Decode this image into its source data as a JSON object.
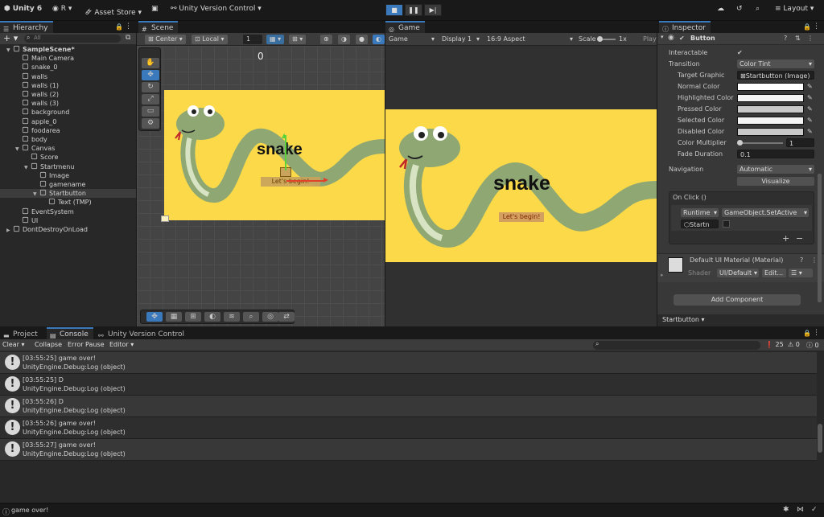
{
  "topbar": {
    "app_label": "Unity 6",
    "account_label": "R",
    "asset_store_label": "Asset Store",
    "version_control_label": "Unity Version Control",
    "layout_label": "Layout"
  },
  "hierarchy": {
    "tab_label": "Hierarchy",
    "search_placeholder": "All",
    "items": [
      {
        "label": "SampleScene*",
        "depth": 0
      },
      {
        "label": "Main Camera",
        "depth": 1
      },
      {
        "label": "snake_0",
        "depth": 1
      },
      {
        "label": "walls",
        "depth": 1
      },
      {
        "label": "walls (1)",
        "depth": 1
      },
      {
        "label": "walls (2)",
        "depth": 1
      },
      {
        "label": "walls (3)",
        "depth": 1
      },
      {
        "label": "background",
        "depth": 1
      },
      {
        "label": "apple_0",
        "depth": 1
      },
      {
        "label": "foodarea",
        "depth": 1
      },
      {
        "label": "body",
        "depth": 1
      },
      {
        "label": "Canvas",
        "depth": 1
      },
      {
        "label": "Score",
        "depth": 2
      },
      {
        "label": "Startmenu",
        "depth": 2
      },
      {
        "label": "Image",
        "depth": 3
      },
      {
        "label": "gamename",
        "depth": 3
      },
      {
        "label": "Startbutton",
        "depth": 3
      },
      {
        "label": "Text (TMP)",
        "depth": 4
      },
      {
        "label": "EventSystem",
        "depth": 1
      },
      {
        "label": "UI",
        "depth": 1
      },
      {
        "label": "DontDestroyOnLoad",
        "depth": 0
      }
    ]
  },
  "scene": {
    "tab_label": "Scene",
    "pivot_label": "Center",
    "space_label": "Local",
    "snap_value": "1",
    "score_text": "0",
    "title_text": "snake",
    "button_text": "Let's begin!"
  },
  "game": {
    "tab_label": "Game",
    "mode_label": "Game",
    "display_label": "Display 1",
    "aspect_label": "16:9 Aspect",
    "scale_label": "Scale",
    "scale_value": "1x",
    "play_label": "Play",
    "title_text": "snake",
    "button_text": "Let's begin!"
  },
  "inspector": {
    "tab_label": "Inspector",
    "component_title": "Button",
    "interactable_label": "Interactable",
    "transition_label": "Transition",
    "transition_value": "Color Tint",
    "target_graphic_label": "Target Graphic",
    "target_graphic_value": "Startbutton (Image)",
    "normal_color_label": "Normal Color",
    "highlighted_color_label": "Highlighted Color",
    "pressed_color_label": "Pressed Color",
    "selected_color_label": "Selected Color",
    "disabled_color_label": "Disabled Color",
    "color_multiplier_label": "Color Multiplier",
    "color_multiplier_value": "1",
    "fade_duration_label": "Fade Duration",
    "fade_duration_value": "0.1",
    "navigation_label": "Navigation",
    "navigation_value": "Automatic",
    "visualize_label": "Visualize",
    "onclick_label": "On Click ()",
    "runtime_value": "Runtime",
    "function_value": "GameObject.SetActive",
    "object_value": "Startn",
    "material_title": "Default UI Material (Material)",
    "shader_label": "Shader",
    "shader_value": "UI/Default",
    "edit_label": "Edit...",
    "add_component_label": "Add Component",
    "footer_object": "Startbutton"
  },
  "console": {
    "project_tab": "Project",
    "console_tab": "Console",
    "vc_tab": "Unity Version Control",
    "clear_label": "Clear",
    "collapse_label": "Collapse",
    "error_pause_label": "Error Pause",
    "editor_label": "Editor",
    "log_count": "25",
    "warn_count": "0",
    "error_count": "0",
    "entries": [
      {
        "line1": "[03:55:25] game over!",
        "line2": "UnityEngine.Debug:Log (object)"
      },
      {
        "line1": "[03:55:25] D",
        "line2": "UnityEngine.Debug:Log (object)"
      },
      {
        "line1": "[03:55:26] D",
        "line2": "UnityEngine.Debug:Log (object)"
      },
      {
        "line1": "[03:55:26] game over!",
        "line2": "UnityEngine.Debug:Log (object)"
      },
      {
        "line1": "[03:55:27] game over!",
        "line2": "UnityEngine.Debug:Log (object)"
      }
    ]
  },
  "statusbar": {
    "message": "game over!"
  },
  "colors": {
    "accent": "#3a79bb",
    "game_bg": "#fbd948",
    "snake_green": "#8fa873"
  }
}
